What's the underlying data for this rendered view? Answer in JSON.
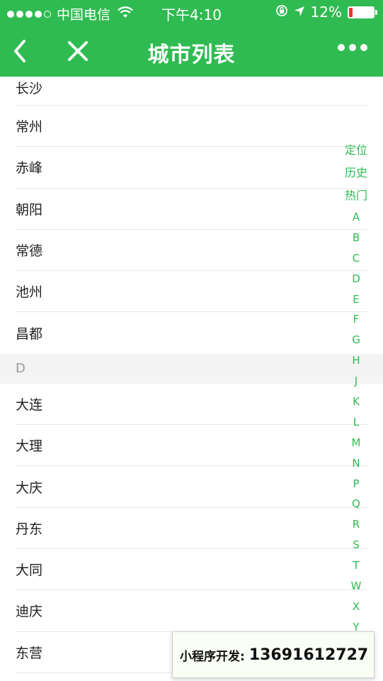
{
  "status_bar": {
    "carrier": "中国电信",
    "time": "下午4:10",
    "battery": "12%",
    "signal_filled": 4,
    "signal_total": 5
  },
  "nav": {
    "title": "城市列表"
  },
  "list": {
    "cities_c": [
      "长沙",
      "常州",
      "赤峰",
      "朝阳",
      "常德",
      "池州",
      "昌都"
    ],
    "section_d": "D",
    "cities_d": [
      "大连",
      "大理",
      "大庆",
      "丹东",
      "大同",
      "迪庆",
      "东营"
    ]
  },
  "index_bar": {
    "top_items": [
      "定位",
      "历史",
      "热门"
    ],
    "letters": [
      "A",
      "B",
      "C",
      "D",
      "E",
      "F",
      "G",
      "H",
      "J",
      "K",
      "L",
      "M",
      "N",
      "P",
      "Q",
      "R",
      "S",
      "T",
      "W",
      "X",
      "Y"
    ]
  },
  "promo": {
    "label": "小程序开发:",
    "number": "13691612727"
  },
  "colors": {
    "accent": "#2fbb51",
    "battery_low": "#e33333"
  }
}
